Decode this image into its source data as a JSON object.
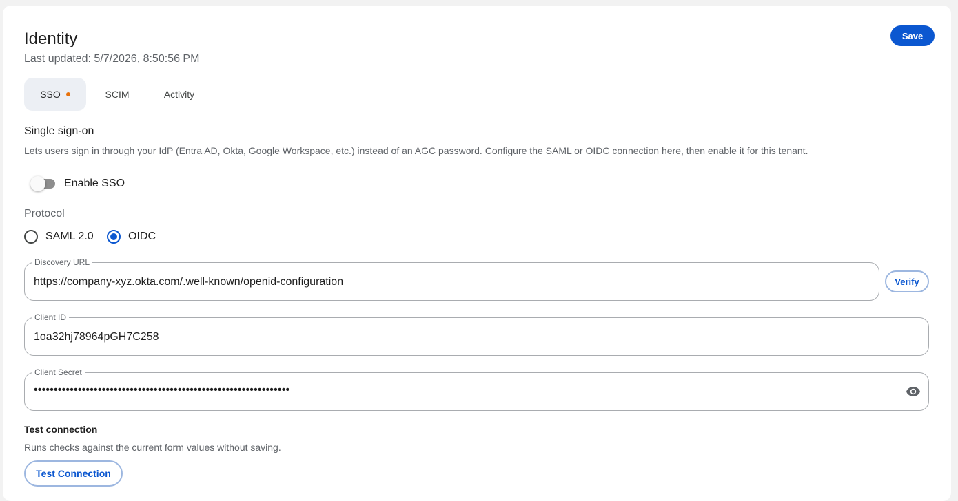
{
  "header": {
    "title": "Identity",
    "last_updated": "Last updated: 5/7/2026, 8:50:56 PM",
    "save_label": "Save"
  },
  "tabs": [
    {
      "label": "SSO",
      "active": true,
      "has_indicator": true
    },
    {
      "label": "SCIM",
      "active": false
    },
    {
      "label": "Activity",
      "active": false
    }
  ],
  "sso": {
    "title": "Single sign-on",
    "description": "Lets users sign in through your IdP (Entra AD, Okta, Google Workspace, etc.) instead of an AGC password. Configure the SAML or OIDC connection here, then enable it for this tenant.",
    "enable_label": "Enable SSO",
    "enabled": false,
    "protocol_label": "Protocol",
    "protocol_options": [
      "SAML 2.0",
      "OIDC"
    ],
    "protocol_selected": "OIDC",
    "discovery_url": {
      "label": "Discovery URL",
      "value": "https://company-xyz.okta.com/.well-known/openid-configuration",
      "verify_label": "Verify"
    },
    "client_id": {
      "label": "Client ID",
      "value": "1oa32hj78964pGH7C258"
    },
    "client_secret": {
      "label": "Client Secret",
      "masked_value": "••••••••••••••••••••••••••••••••••••••••••••••••••••••••••••••••"
    }
  },
  "test": {
    "title": "Test connection",
    "description": "Runs checks against the current form values without saving.",
    "button_label": "Test Connection"
  },
  "colors": {
    "primary": "#0b57d0",
    "indicator": "#e8710a",
    "active_tab_bg": "#eceff4"
  }
}
